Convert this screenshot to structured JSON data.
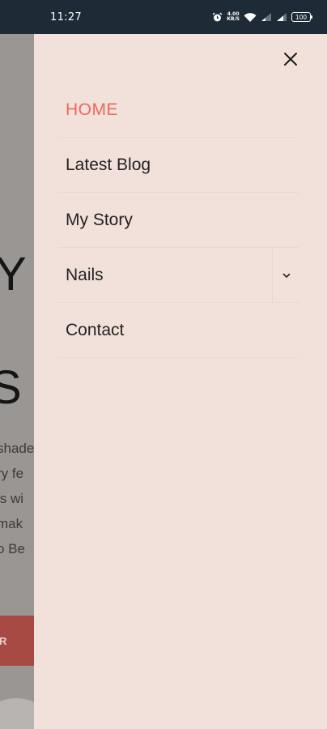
{
  "status_bar": {
    "time": "11:27",
    "net_speed_value": "4.00",
    "net_speed_unit": "KB/S",
    "battery": "100",
    "icons": [
      "alarm-icon",
      "wifi-icon",
      "signal-icon",
      "signal-icon",
      "battery-icon"
    ]
  },
  "background_page": {
    "heading_1": "Y",
    "heading_2": "S",
    "body_lines": [
      "shade",
      "ry fe",
      "is wi",
      "mak",
      "o Be"
    ],
    "button_label": "R"
  },
  "drawer": {
    "close_icon": "close-icon",
    "menu": [
      {
        "label": "HOME",
        "active": true
      },
      {
        "label": "Latest Blog"
      },
      {
        "label": "My Story"
      },
      {
        "label": "Nails",
        "has_submenu": true,
        "submenu_icon": "chevron-down-icon"
      },
      {
        "label": "Contact"
      }
    ]
  },
  "colors": {
    "status_bar_bg": "#1e2a36",
    "drawer_bg": "#f2e1da",
    "active_item": "#ea6a5a",
    "text": "#222222"
  }
}
